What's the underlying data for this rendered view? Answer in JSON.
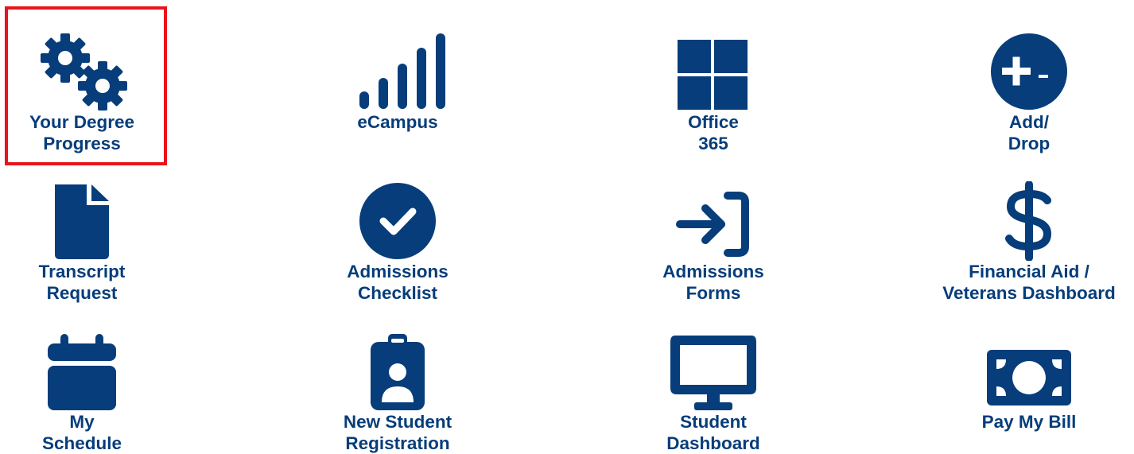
{
  "highlight_color": "#e8141b",
  "icon_color": "#063d7a",
  "tiles": [
    {
      "line1": "Your Degree",
      "line2": "Progress",
      "icon": "gears-icon",
      "highlighted": true
    },
    {
      "line1": "eCampus",
      "line2": "",
      "icon": "signal-bars-icon"
    },
    {
      "line1": "Office",
      "line2": "365",
      "icon": "windows-grid-icon"
    },
    {
      "line1": "Add/",
      "line2": "Drop",
      "icon": "plus-minus-circle-icon"
    },
    {
      "line1": "Transcript",
      "line2": "Request",
      "icon": "document-icon"
    },
    {
      "line1": "Admissions",
      "line2": "Checklist",
      "icon": "check-circle-icon"
    },
    {
      "line1": "Admissions",
      "line2": "Forms",
      "icon": "sign-in-icon"
    },
    {
      "line1": "Financial Aid /",
      "line2": "Veterans Dashboard",
      "icon": "dollar-icon"
    },
    {
      "line1": "My",
      "line2": "Schedule",
      "icon": "calendar-icon"
    },
    {
      "line1": "New Student",
      "line2": "Registration",
      "icon": "id-badge-icon"
    },
    {
      "line1": "Student",
      "line2": "Dashboard",
      "icon": "monitor-icon"
    },
    {
      "line1": "Pay My Bill",
      "line2": "",
      "icon": "money-bill-icon"
    }
  ]
}
